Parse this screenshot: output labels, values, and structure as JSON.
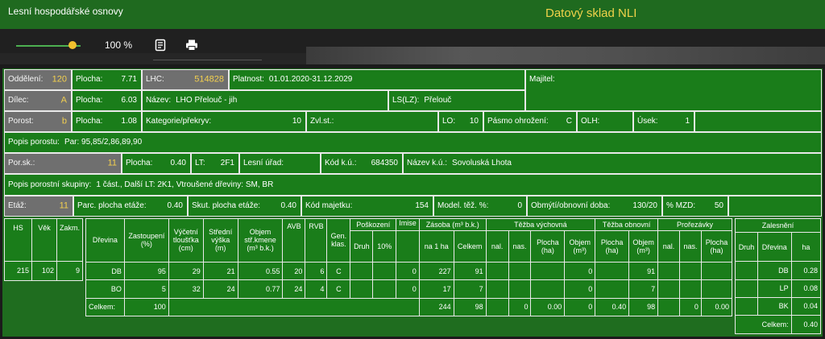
{
  "app_title": "Lesní hospodářské osnovy",
  "center_title": "Datový sklad NLI",
  "toolbar": {
    "zoom": "100 %",
    "zoom_level": 0.85,
    "notes_icon": "notes-icon",
    "print_icon": "print-icon"
  },
  "colors": {
    "header": "#1f6a1f",
    "cell": "#1a7d1a",
    "grey": "#6f6f6f",
    "accent": "#f3d04f"
  },
  "rows": {
    "oddeleni": {
      "label": "Oddělení:",
      "value": "120"
    },
    "plocha1": {
      "label": "Plocha:",
      "value": "7.71"
    },
    "lhc": {
      "label": "LHC:",
      "value": "514828"
    },
    "platnost": {
      "label": "Platnost:",
      "value": "01.01.2020-31.12.2029"
    },
    "majitel": {
      "label": "Majitel:"
    },
    "dilec": {
      "label": "Dílec:",
      "value": "A"
    },
    "plocha2": {
      "label": "Plocha:",
      "value": "6.03"
    },
    "nazev": {
      "label": "Název:",
      "value": "LHO Přelouč - jih"
    },
    "lslz": {
      "label": "LS(LZ):",
      "value": "Přelouč"
    },
    "porost": {
      "label": "Porost:",
      "value": "b"
    },
    "plocha3": {
      "label": "Plocha:",
      "value": "1.08"
    },
    "kategorie": {
      "label": "Kategorie/překryv:",
      "value": "10"
    },
    "zvlst": {
      "label": "Zvl.st.:"
    },
    "lo": {
      "label": "LO:",
      "value": "10"
    },
    "pasmo": {
      "label": "Pásmo ohrožení:",
      "value": "C"
    },
    "olh": {
      "label": "OLH:"
    },
    "usek": {
      "label": "Úsek:",
      "value": "1"
    },
    "popis_porostu": {
      "label": "Popis porostu:",
      "value": "Par: 95,85/2,86,89,90"
    },
    "porsk": {
      "label": "Por.sk.:",
      "value": "11"
    },
    "plocha4": {
      "label": "Plocha:",
      "value": "0.40"
    },
    "lt": {
      "label": "LT:",
      "value": "2F1"
    },
    "lesni_urad": {
      "label": "Lesní úřad:"
    },
    "kod_ku": {
      "label": "Kód k.ú.:",
      "value": "684350"
    },
    "nazev_ku": {
      "label": "Název k.ú.:",
      "value": "Sovoluská Lhota"
    },
    "popis_skupiny": {
      "label": "Popis porostní skupiny:",
      "value": "1 část., Další LT: 2K1, Vtroušené dřeviny: SM, BR"
    },
    "etaz": {
      "label": "Etáž:",
      "value": "11"
    },
    "parc_plocha": {
      "label": "Parc. plocha etáže:",
      "value": "0.40"
    },
    "skut_plocha": {
      "label": "Skut. plocha etáže:",
      "value": "0.40"
    },
    "kod_majetku": {
      "label": "Kód majetku:",
      "value": "154"
    },
    "model_tez": {
      "label": "Model. těž. %:",
      "value": "0"
    },
    "obmyti": {
      "label": "Obmýtí/obnovní doba:",
      "value": "130/20"
    },
    "mzd": {
      "label": "% MZD:",
      "value": "50"
    }
  },
  "hs_table": {
    "headers": [
      "HS",
      "Věk",
      "Zakm."
    ],
    "row": [
      "215",
      "102",
      "9"
    ]
  },
  "main_table": {
    "h1": {
      "drevina": "Dřevina",
      "zastoupeni": "Zastoupení (%)",
      "vycetni": "Výčetní tloušťka (cm)",
      "stredni": "Střední výška (m)",
      "objem": "Objem stř.kmene (m³ b.k.)",
      "avb": "AVB",
      "rvb": "RVB",
      "gen": "Gen. klas.",
      "poskozeni": "Poškození",
      "imise": "Imise",
      "zasoba": "Zásoba (m³ b.k.)",
      "tezba_vych": "Těžba výchovná",
      "tezba_obn": "Těžba obnovní",
      "prorezavky": "Prořezávky"
    },
    "h2": {
      "druh": "Druh",
      "p10": "10%",
      "na1ha": "na 1 ha",
      "celkem": "Celkem",
      "nal1": "nal.",
      "nas1": "nas.",
      "plocha1": "Plocha (ha)",
      "objem1": "Objem (m³)",
      "plocha2": "Plocha (ha)",
      "objem2": "Objem (m³)",
      "nal2": "nal.",
      "nas2": "nas.",
      "plocha3": "Plocha (ha)"
    },
    "rows": [
      {
        "drevina": "DB",
        "zast": "95",
        "vyc": "29",
        "str": "21",
        "obj": "0.55",
        "avb": "20",
        "rvb": "6",
        "gen": "C",
        "imise": "0",
        "na1ha": "227",
        "celkem": "91",
        "tv_objem": "0",
        "to_objem": "91"
      },
      {
        "drevina": "BO",
        "zast": "5",
        "vyc": "32",
        "str": "24",
        "obj": "0.77",
        "avb": "24",
        "rvb": "4",
        "gen": "C",
        "imise": "0",
        "na1ha": "17",
        "celkem": "7",
        "tv_objem": "0",
        "to_objem": "7"
      }
    ],
    "total": {
      "label": "Celkem:",
      "zast": "100",
      "na1ha": "244",
      "celkem": "98",
      "tv_nas": "0",
      "tv_plocha": "0.00",
      "tv_objem": "0",
      "to_plocha": "0.40",
      "to_objem": "98",
      "pr_nas": "0",
      "pr_plocha": "0.00"
    }
  },
  "zalesneni": {
    "title": "Zalesnění",
    "headers": [
      "Druh",
      "Dřevina",
      "ha"
    ],
    "rows": [
      {
        "drevina": "DB",
        "ha": "0.28"
      },
      {
        "drevina": "LP",
        "ha": "0.08"
      },
      {
        "drevina": "BK",
        "ha": "0.04"
      }
    ],
    "total_label": "Celkem:",
    "total": "0.40"
  }
}
